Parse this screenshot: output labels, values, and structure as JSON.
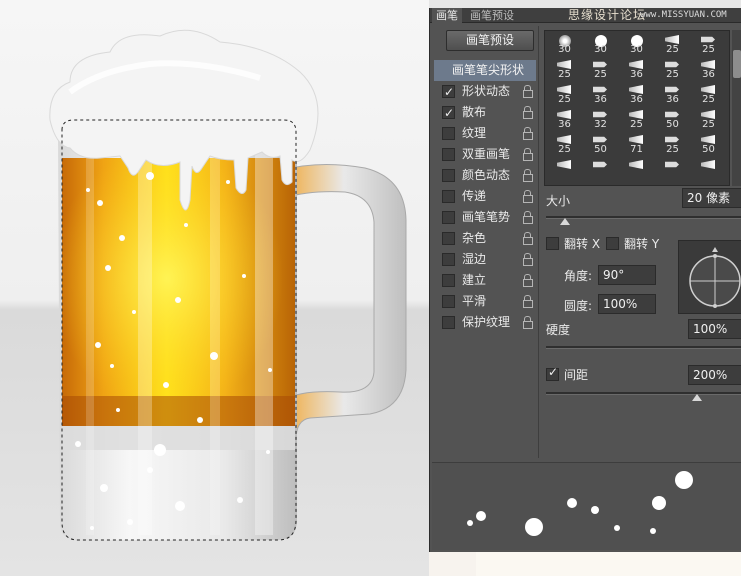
{
  "panel": {
    "tabs": [
      "画笔",
      "画笔预设"
    ],
    "watermark": "思缘设计论坛",
    "watermark_url": "www.MISSYUAN.COM",
    "preset_button": "画笔预设",
    "category_header": "画笔笔尖形状",
    "categories": [
      {
        "label": "形状动态",
        "checked": true
      },
      {
        "label": "散布",
        "checked": true
      },
      {
        "label": "纹理",
        "checked": false
      },
      {
        "label": "双重画笔",
        "checked": false
      },
      {
        "label": "颜色动态",
        "checked": false
      },
      {
        "label": "传递",
        "checked": false
      },
      {
        "label": "画笔笔势",
        "checked": false
      },
      {
        "label": "杂色",
        "checked": false
      },
      {
        "label": "湿边",
        "checked": false
      },
      {
        "label": "建立",
        "checked": false
      },
      {
        "label": "平滑",
        "checked": false
      },
      {
        "label": "保护纹理",
        "checked": false
      }
    ],
    "brush_sizes": [
      [
        "30",
        "30",
        "30",
        "25",
        "25"
      ],
      [
        "25",
        "25",
        "36",
        "25",
        "36"
      ],
      [
        "25",
        "36",
        "36",
        "36",
        "25"
      ],
      [
        "36",
        "32",
        "25",
        "50",
        "25"
      ],
      [
        "25",
        "50",
        "71",
        "25",
        "50"
      ],
      [
        "",
        "",
        "",
        "",
        ""
      ]
    ],
    "size_label": "大小",
    "size_value": "20 像素",
    "flip_x_label": "翻转 X",
    "flip_y_label": "翻转 Y",
    "angle_label": "角度:",
    "angle_value": "90°",
    "roundness_label": "圆度:",
    "roundness_value": "100%",
    "hardness_label": "硬度",
    "hardness_value": "100%",
    "spacing_label": "间距",
    "spacing_value": "200%",
    "spacing_checked": true
  }
}
